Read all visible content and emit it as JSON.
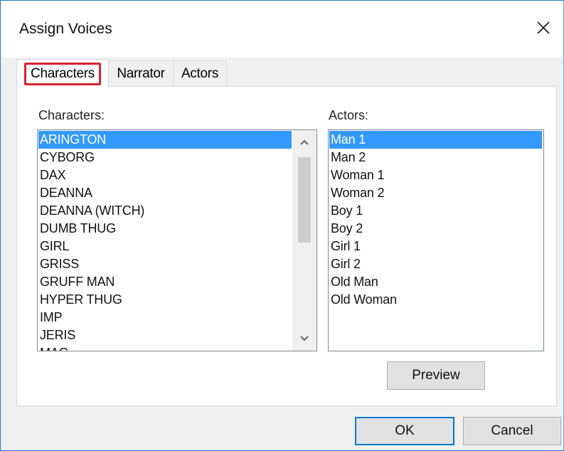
{
  "window": {
    "title": "Assign Voices"
  },
  "tabs": [
    {
      "label": "Characters",
      "active": true
    },
    {
      "label": "Narrator",
      "active": false
    },
    {
      "label": "Actors",
      "active": false
    }
  ],
  "characters": {
    "label": "Characters:",
    "items": [
      "ARINGTON",
      "CYBORG",
      "DAX",
      "DEANNA",
      "DEANNA (WITCH)",
      "DUMB THUG",
      "GIRL",
      "GRISS",
      "GRUFF MAN",
      "HYPER THUG",
      "IMP",
      "JERIS",
      "MAG"
    ],
    "selected": "ARINGTON"
  },
  "actors": {
    "label": "Actors:",
    "items": [
      "Man 1",
      "Man 2",
      "Woman 1",
      "Woman 2",
      "Boy 1",
      "Boy 2",
      "Girl 1",
      "Girl 2",
      "Old Man",
      "Old Woman"
    ],
    "selected": "Man 1"
  },
  "buttons": {
    "preview": "Preview",
    "ok": "OK",
    "cancel": "Cancel"
  },
  "colors": {
    "highlight": "#3399ff",
    "tab_callout": "#d9232e",
    "default_button_border": "#0078d7"
  }
}
